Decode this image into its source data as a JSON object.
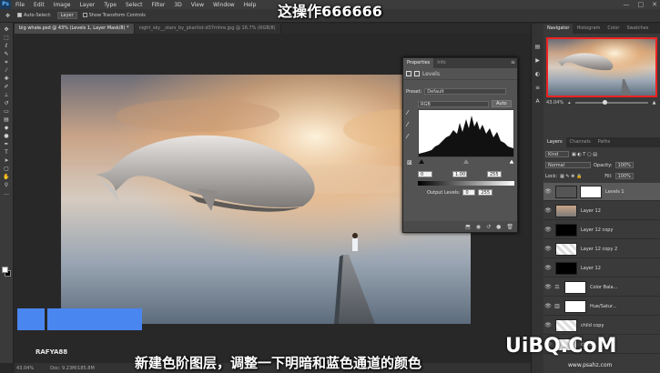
{
  "overlay": {
    "title": "这操作666666",
    "subtitle": "新建色阶图层，调整一下明暗和蓝色通道的颜色",
    "brand": "RAFYA88",
    "logo": "UiBQ.CoM",
    "site": "www.psahz.com"
  },
  "app": {
    "logo": "Ps"
  },
  "menu": [
    "File",
    "Edit",
    "Image",
    "Layer",
    "Type",
    "Select",
    "Filter",
    "3D",
    "View",
    "Window",
    "Help"
  ],
  "window_controls": [
    "—",
    "□",
    "✕"
  ],
  "options": {
    "auto_select_label": "Auto-Select:",
    "auto_select_value": "Layer",
    "show_transform_label": "Show Transform Controls"
  },
  "tabs": [
    {
      "label": "big whale.psd @ 43% (Levels 1, Layer Mask/8) *",
      "active": true
    },
    {
      "label": "night_sky__stars_by_pkartist-d37mhre.jpg @ 16.7% (RGB/8)",
      "active": false
    }
  ],
  "status": {
    "zoom": "43.04%",
    "doc": "Doc: 9.23M/185.8M"
  },
  "properties": {
    "tabs": [
      "Properties",
      "Info"
    ],
    "section": "Levels",
    "preset_label": "Preset:",
    "preset_value": "Default",
    "channel_value": "RGB",
    "auto_label": "Auto",
    "input_black": "0",
    "input_gray": "1.00",
    "input_white": "255",
    "output_label": "Output Levels:",
    "output_black": "0",
    "output_white": "255"
  },
  "navigator": {
    "tabs": [
      "Navigator",
      "Histogram",
      "Color",
      "Swatches"
    ],
    "zoom": "43.04%"
  },
  "layers_panel": {
    "tabs": [
      "Layers",
      "Channels",
      "Paths"
    ],
    "kind_label": "Kind",
    "blend_mode": "Normal",
    "opacity_label": "Opacity:",
    "opacity_value": "100%",
    "lock_label": "Lock:",
    "fill_label": "Fill:",
    "fill_value": "100%",
    "layers": [
      {
        "name": "Levels 1",
        "selected": true
      },
      {
        "name": "Layer 12",
        "selected": false
      },
      {
        "name": "Layer 12 copy",
        "selected": false
      },
      {
        "name": "Layer 12 copy 2",
        "selected": false
      },
      {
        "name": "Layer 12",
        "selected": false
      },
      {
        "name": "Color Bala...",
        "selected": false
      },
      {
        "name": "Hue/Satur...",
        "selected": false
      },
      {
        "name": "child copy",
        "selected": false
      },
      {
        "name": "child",
        "selected": false
      }
    ]
  },
  "icons": {
    "eye": "eye-icon",
    "move": "move-tool-icon"
  },
  "colors": {
    "accent_blue": "#4a86f0",
    "nav_frame": "#ee2222"
  }
}
